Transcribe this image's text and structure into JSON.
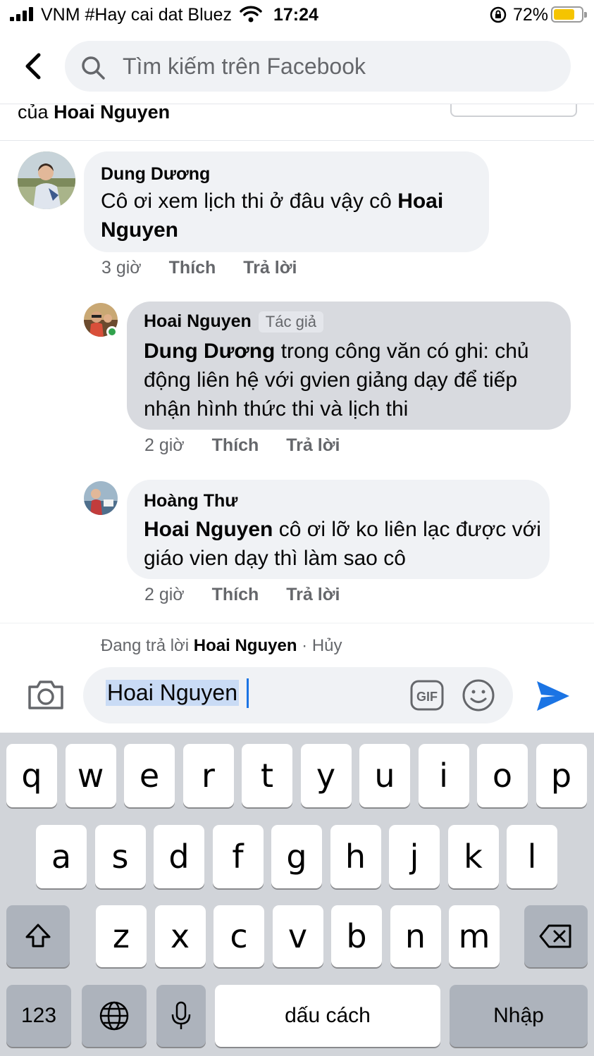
{
  "status_bar": {
    "carrier": "VNM #Hay cai dat Bluez",
    "time": "17:24",
    "battery": "72%",
    "battery_level": 0.72
  },
  "search": {
    "placeholder": "Tìm kiếm trên Facebook"
  },
  "context": {
    "prefix": "của",
    "name": "Hoai Nguyen"
  },
  "comments": [
    {
      "author": "Dung Dương",
      "text_plain": "Cô ơi xem lịch thi ở đâu vậy cô",
      "mention": "Hoai Nguyen",
      "time": "3 giờ",
      "like": "Thích",
      "reply": "Trả lời"
    },
    {
      "author": "Hoai Nguyen",
      "badge": "Tác giả",
      "mention": "Dung Dương",
      "text_after": "trong công văn có ghi: chủ động liên hệ với gvien giảng dạy để tiếp nhận hình thức thi và lịch thi",
      "time": "2 giờ",
      "like": "Thích",
      "reply": "Trả lời"
    },
    {
      "author": "Hoàng Thư",
      "mention": "Hoai Nguyen",
      "text_after": "cô ơi lỡ ko liên lạc được với giáo vien dạy thì làm sao cô",
      "time": "2 giờ",
      "like": "Thích",
      "reply": "Trả lời"
    }
  ],
  "reply_bar": {
    "replying_label": "Đang trả lời",
    "replying_to": "Hoai Nguyen",
    "separator": "·",
    "cancel": "Hủy",
    "input_value": "Hoai Nguyen",
    "gif_label": "GIF"
  },
  "keyboard": {
    "row1": [
      "q",
      "w",
      "e",
      "r",
      "t",
      "y",
      "u",
      "i",
      "o",
      "p"
    ],
    "row2": [
      "a",
      "s",
      "d",
      "f",
      "g",
      "h",
      "j",
      "k",
      "l"
    ],
    "row3": [
      "z",
      "x",
      "c",
      "v",
      "b",
      "n",
      "m"
    ],
    "numbers": "123",
    "space": "dấu cách",
    "return": "Nhập"
  }
}
